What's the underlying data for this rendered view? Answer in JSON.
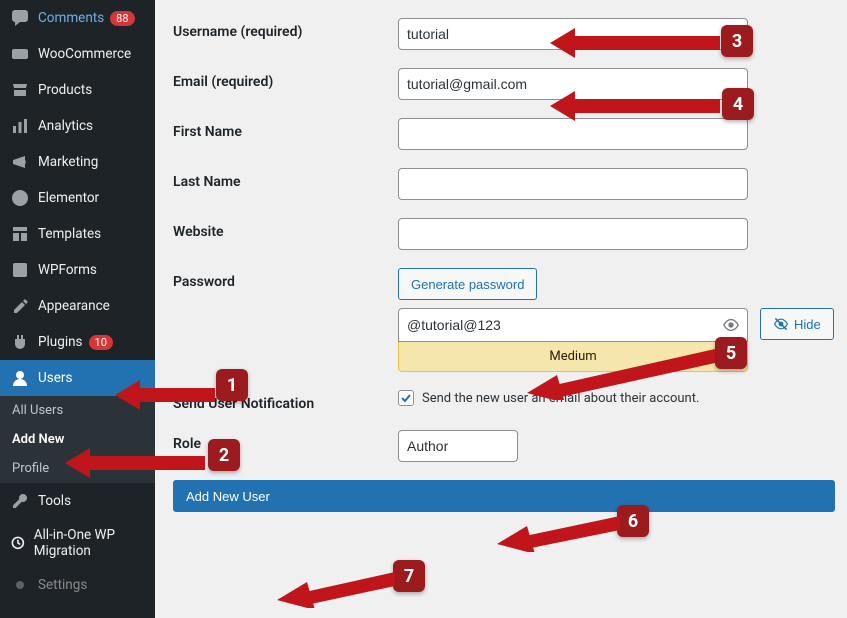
{
  "sidebar": {
    "items": [
      {
        "label": "Comments",
        "badge": "88",
        "icon": "comments"
      },
      {
        "label": "WooCommerce",
        "icon": "woo"
      },
      {
        "label": "Products",
        "icon": "products"
      },
      {
        "label": "Analytics",
        "icon": "analytics"
      },
      {
        "label": "Marketing",
        "icon": "marketing"
      },
      {
        "label": "Elementor",
        "icon": "elementor"
      },
      {
        "label": "Templates",
        "icon": "templates"
      },
      {
        "label": "WPForms",
        "icon": "wpforms"
      },
      {
        "label": "Appearance",
        "icon": "appearance"
      },
      {
        "label": "Plugins",
        "badge": "10",
        "icon": "plugins"
      },
      {
        "label": "Users",
        "icon": "users",
        "active": true
      },
      {
        "label": "Tools",
        "icon": "tools"
      },
      {
        "label": "All-in-One WP Migration",
        "icon": "migration"
      },
      {
        "label": "Settings",
        "icon": "settings"
      }
    ],
    "submenu": [
      {
        "label": "All Users"
      },
      {
        "label": "Add New",
        "selected": true
      },
      {
        "label": "Profile"
      }
    ]
  },
  "form": {
    "username": {
      "label": "Username (required)",
      "value": "tutorial"
    },
    "email": {
      "label": "Email (required)",
      "value": "tutorial@gmail.com"
    },
    "first_name": {
      "label": "First Name",
      "value": ""
    },
    "last_name": {
      "label": "Last Name",
      "value": ""
    },
    "website": {
      "label": "Website",
      "value": ""
    },
    "password": {
      "label": "Password",
      "generate_btn": "Generate password",
      "value": "@tutorial@123",
      "strength": "Medium",
      "hide_btn": "Hide"
    },
    "notification": {
      "label": "Send User Notification",
      "checkbox_text": "Send the new user an email about their account.",
      "checked": true
    },
    "role": {
      "label": "Role",
      "value": "Author"
    },
    "submit": "Add New User"
  },
  "annotations": {
    "n1": "1",
    "n2": "2",
    "n3": "3",
    "n4": "4",
    "n5": "5",
    "n6": "6",
    "n7": "7"
  }
}
